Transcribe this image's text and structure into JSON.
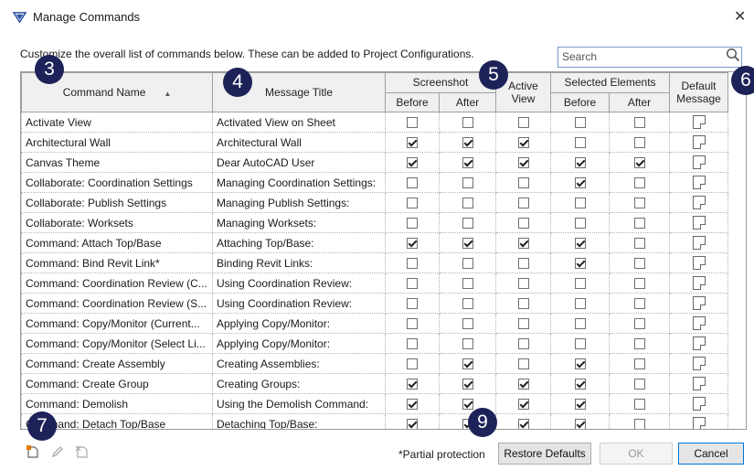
{
  "window": {
    "title": "Manage Commands"
  },
  "description": "Customize the overall list of commands below. These can be added to Project Configurations.",
  "search": {
    "placeholder": "Search",
    "value": ""
  },
  "columns": {
    "command_name": "Command Name",
    "message_title": "Message Title",
    "screenshot": "Screenshot",
    "active_view": "Active View",
    "selected_elements": "Selected Elements",
    "default_message": "Default Message",
    "before": "Before",
    "after": "After"
  },
  "rows": [
    {
      "name": "Activate View",
      "title": "Activated View on Sheet",
      "sb": false,
      "sa": false,
      "av": false,
      "eb": false,
      "ea": false
    },
    {
      "name": "Architectural Wall",
      "title": "Architectural Wall",
      "sb": true,
      "sa": true,
      "av": true,
      "eb": false,
      "ea": false
    },
    {
      "name": "Canvas Theme",
      "title": "Dear AutoCAD User",
      "sb": true,
      "sa": true,
      "av": true,
      "eb": true,
      "ea": true
    },
    {
      "name": "Collaborate: Coordination Settings",
      "title": "Managing Coordination Settings:",
      "sb": false,
      "sa": false,
      "av": false,
      "eb": true,
      "ea": false
    },
    {
      "name": "Collaborate: Publish Settings",
      "title": "Managing Publish Settings:",
      "sb": false,
      "sa": false,
      "av": false,
      "eb": false,
      "ea": false
    },
    {
      "name": "Collaborate: Worksets",
      "title": "Managing Worksets:",
      "sb": false,
      "sa": false,
      "av": false,
      "eb": false,
      "ea": false
    },
    {
      "name": "Command: Attach Top/Base",
      "title": "Attaching Top/Base:",
      "sb": true,
      "sa": true,
      "av": true,
      "eb": true,
      "ea": false
    },
    {
      "name": "Command: Bind Revit Link*",
      "title": "Binding Revit Links:",
      "sb": false,
      "sa": false,
      "av": false,
      "eb": true,
      "ea": false
    },
    {
      "name": "Command: Coordination Review (C...",
      "title": "Using Coordination Review:",
      "sb": false,
      "sa": false,
      "av": false,
      "eb": false,
      "ea": false
    },
    {
      "name": "Command: Coordination Review (S...",
      "title": "Using Coordination Review:",
      "sb": false,
      "sa": false,
      "av": false,
      "eb": false,
      "ea": false
    },
    {
      "name": "Command: Copy/Monitor (Current...",
      "title": "Applying Copy/Monitor:",
      "sb": false,
      "sa": false,
      "av": false,
      "eb": false,
      "ea": false
    },
    {
      "name": "Command: Copy/Monitor (Select Li...",
      "title": "Applying Copy/Monitor:",
      "sb": false,
      "sa": false,
      "av": false,
      "eb": false,
      "ea": false
    },
    {
      "name": "Command: Create Assembly",
      "title": "Creating Assemblies:",
      "sb": false,
      "sa": true,
      "av": false,
      "eb": true,
      "ea": false
    },
    {
      "name": "Command: Create Group",
      "title": "Creating Groups:",
      "sb": true,
      "sa": true,
      "av": true,
      "eb": true,
      "ea": false
    },
    {
      "name": "Command: Demolish",
      "title": "Using the Demolish Command:",
      "sb": true,
      "sa": true,
      "av": true,
      "eb": true,
      "ea": false
    },
    {
      "name": "Command: Detach Top/Base",
      "title": "Detaching Top/Base:",
      "sb": true,
      "sa": true,
      "av": true,
      "eb": true,
      "ea": false
    }
  ],
  "badges": [
    "3",
    "4",
    "5",
    "6",
    "7",
    "9"
  ],
  "footer": {
    "partial_protection": "*Partial protection",
    "restore_defaults": "Restore Defaults",
    "ok": "OK",
    "cancel": "Cancel"
  },
  "colors": {
    "badge": "#1d2358",
    "header_bg": "#f0f0f0",
    "accent": "#0078d7"
  }
}
